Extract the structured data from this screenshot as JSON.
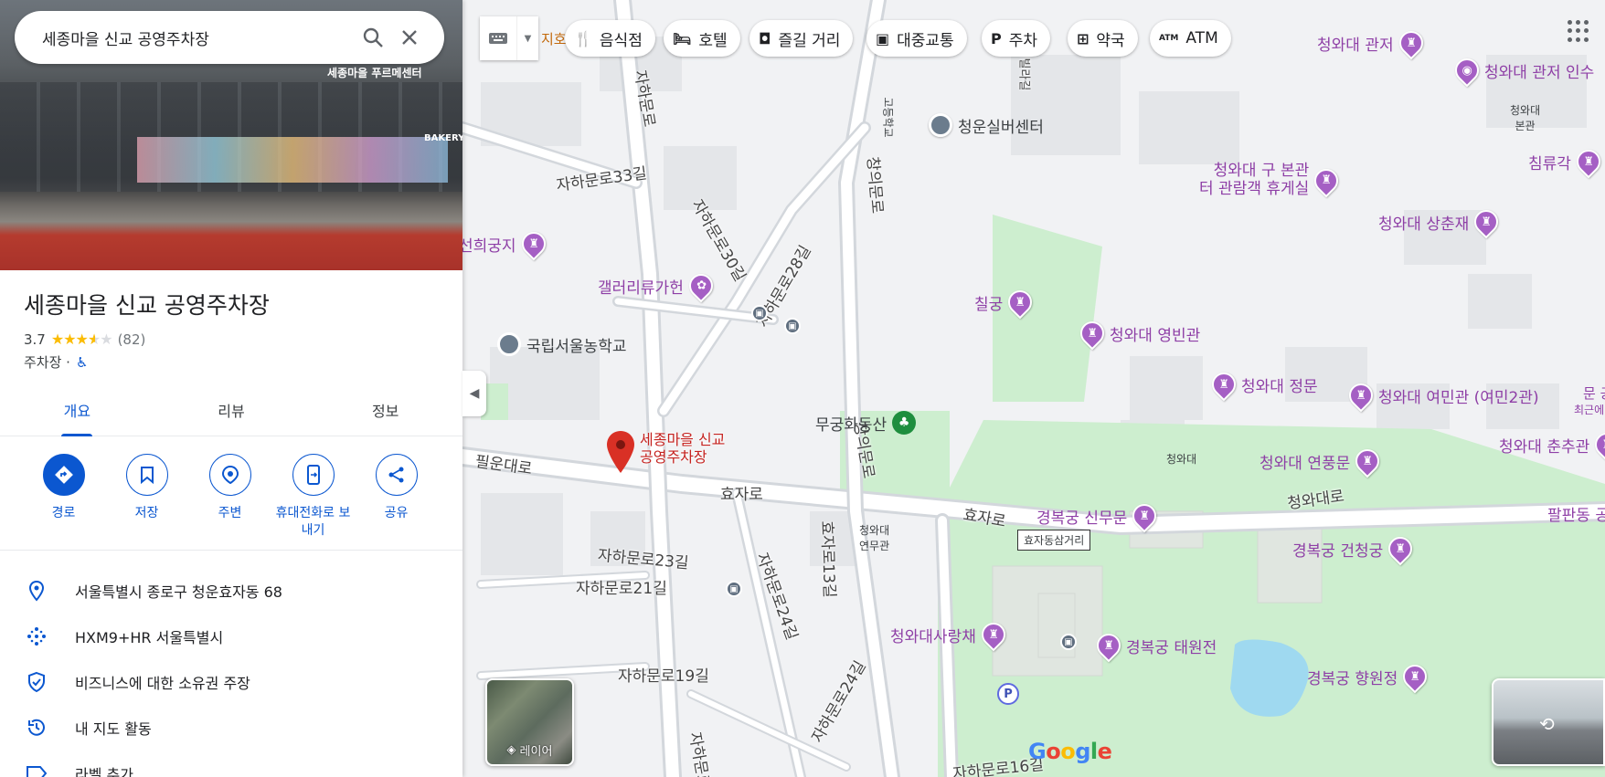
{
  "search": {
    "query": "세종마을 신교 공영주차장"
  },
  "place": {
    "title": "세종마을 신교 공영주차장",
    "rating": "3.7",
    "review_count": "(82)",
    "category": "주차장 ·",
    "hero_sign": "세종마을 푸르메센터",
    "hero_sign2": "BAKERY"
  },
  "tabs": [
    {
      "label": "개요",
      "active": true
    },
    {
      "label": "리뷰",
      "active": false
    },
    {
      "label": "정보",
      "active": false
    }
  ],
  "actions": [
    {
      "label": "경로",
      "icon": "directions-icon"
    },
    {
      "label": "저장",
      "icon": "bookmark-icon"
    },
    {
      "label": "주변",
      "icon": "nearby-icon"
    },
    {
      "label": "휴대전화로 보내기",
      "icon": "send-to-phone-icon"
    },
    {
      "label": "공유",
      "icon": "share-icon"
    }
  ],
  "info": [
    {
      "text": "서울특별시 종로구 청운효자동 68",
      "icon": "location-pin-icon"
    },
    {
      "text": "HXM9+HR 서울특별시",
      "icon": "plus-code-icon"
    },
    {
      "text": "비즈니스에 대한 소유권 주장",
      "icon": "verified-shield-icon"
    },
    {
      "text": "내 지도 활동",
      "icon": "history-icon"
    },
    {
      "text": "라벨 추가",
      "icon": "label-icon"
    }
  ],
  "map": {
    "chips": [
      "음식점",
      "호텔",
      "즐길 거리",
      "대중교통",
      "주차",
      "약국",
      "ATM"
    ],
    "chip_partial_left": "지호",
    "selected_pin_label": [
      "세종마을 신교",
      "공영주차장"
    ],
    "layers_label": "레이어",
    "road_labels": [
      "자하문로33길",
      "자하문로30길",
      "자하문로28길",
      "자하문로",
      "창의문로",
      "필운대로",
      "효자로",
      "효자로",
      "자하문로23길",
      "자하문로21길",
      "자하문로19길",
      "효자로13길",
      "자하문로24길",
      "자하문로24길",
      "청와대로",
      "자하문로16길",
      "대경빌라길",
      "창의문로",
      "자하문로"
    ],
    "places": [
      "청운실버센터",
      "국립서울농학교",
      "무궁화동산",
      "청와대\n연무관",
      "청와대",
      "청와대\n본관",
      "효자동삼거리",
      "고등학교"
    ],
    "purple_pois": [
      "청와대 관저",
      "청와대 관저 인수",
      "청와대 구 본관\n터 관람객 휴게실",
      "침류각",
      "청와대 상춘재",
      "선희궁지",
      "갤러리류가헌",
      "칠궁",
      "청와대 영빈관",
      "청와대 정문",
      "청와대 여민관 (여민2관)",
      "청와대 연풍문",
      "청와대 춘추관",
      "경복궁 신무문",
      "경복궁 건청궁",
      "청와대사랑채",
      "경복궁 태원전",
      "경복궁 향원정",
      "팔판동 공",
      "문 공",
      "최근에"
    ],
    "google_letters": [
      "G",
      "o",
      "o",
      "g",
      "l",
      "e"
    ],
    "colors": {
      "green": "#cdeecf",
      "water": "#9fd9f0",
      "purple": "#8e3fa6",
      "accent": "#0b57d0",
      "red_pin": "#d93025"
    }
  }
}
